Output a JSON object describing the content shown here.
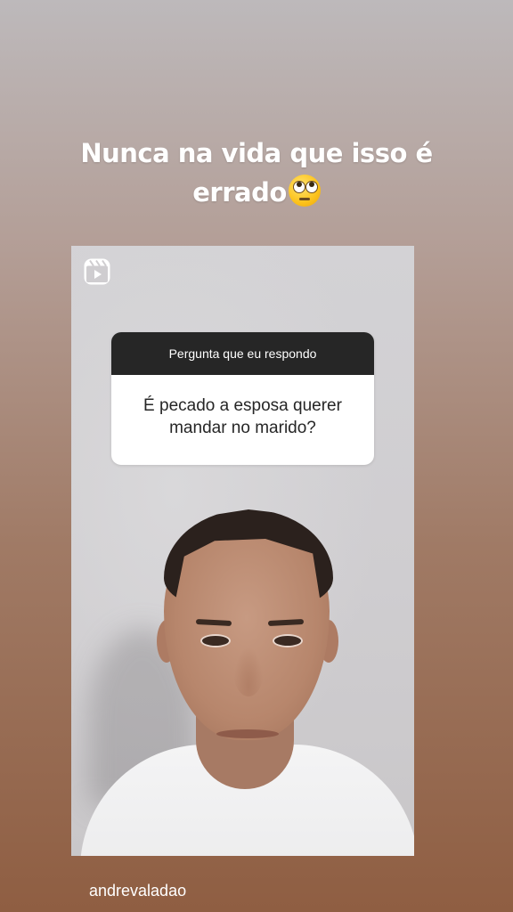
{
  "story": {
    "caption_line1": "Nunca na vida que isso é",
    "caption_line2": "errado",
    "caption_emoji": "face-with-rolling-eyes-emoji",
    "username": "andrevaladao"
  },
  "shared_reel": {
    "icon": "reels-icon",
    "question_sticker": {
      "header": "Pergunta que eu respondo",
      "question": "É pecado a esposa querer mandar no marido?"
    }
  },
  "colors": {
    "sticker_header_bg": "#262626",
    "sticker_body_bg": "#ffffff",
    "caption_text": "#ffffff"
  }
}
